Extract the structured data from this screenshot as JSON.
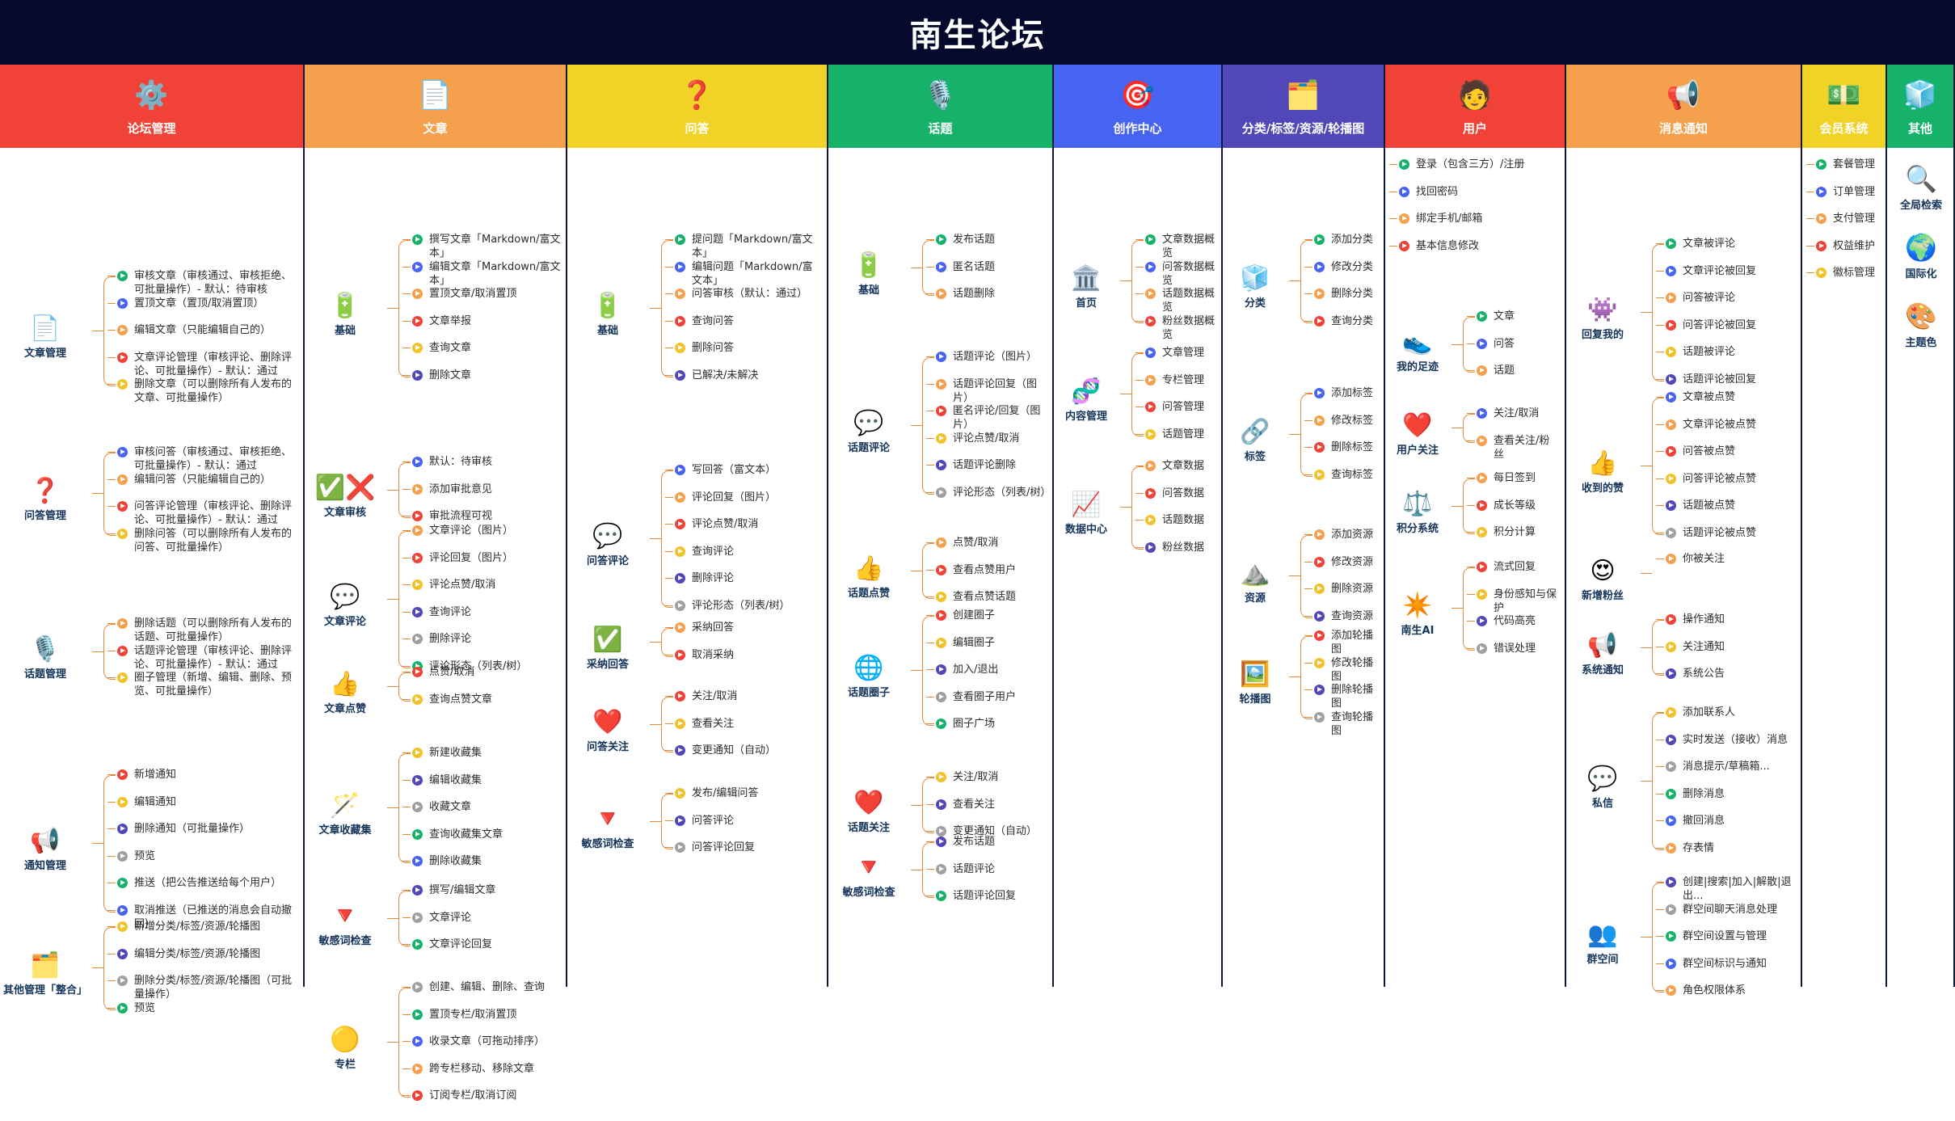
{
  "title": "南生论坛",
  "colors": [
    "#f04236",
    "#f5a04c",
    "#f1d227",
    "#17b26a",
    "#4763f2",
    "#5147b8",
    "#f04236",
    "#f5a04c",
    "#f1d227",
    "#17b26a"
  ],
  "dot_colors": [
    "#17b26a",
    "#4763f2",
    "#f5a04c",
    "#f04236",
    "#f1c229",
    "#5147b8",
    "#a0a0a0"
  ],
  "columns": [
    {
      "name": "论坛管理",
      "icon": "⚙️",
      "groups": [
        {
          "name": "文章管理",
          "icon": "📄",
          "items": [
            "审核文章（审核通过、审核拒绝、可批量操作）- 默认：待审核",
            "置顶文章（置顶/取消置顶）",
            "编辑文章（只能编辑自己的）",
            "文章评论管理（审核评论、删除评论、可批量操作）- 默认：通过",
            "删除文章（可以删除所有人发布的文章、可批量操作）"
          ]
        },
        {
          "name": "问答管理",
          "icon": "❓",
          "items": [
            "审核问答（审核通过、审核拒绝、可批量操作）- 默认：通过",
            "编辑问答（只能编辑自己的）",
            "问答评论管理（审核评论、删除评论、可批量操作）- 默认：通过",
            "删除问答（可以删除所有人发布的问答、可批量操作）"
          ]
        },
        {
          "name": "话题管理",
          "icon": "🎙️",
          "items": [
            "删除话题（可以删除所有人发布的话题、可批量操作）",
            "话题评论管理（审核评论、删除评论、可批量操作）- 默认：通过",
            "圈子管理（新增、编辑、删除、预览、可批量操作）"
          ]
        },
        {
          "name": "通知管理",
          "icon": "📢",
          "items": [
            "新增通知",
            "编辑通知",
            "删除通知（可批量操作）",
            "预览",
            "推送（把公告推送给每个用户）",
            "取消推送（已推送的消息会自动撤回）"
          ]
        },
        {
          "name": "其他管理「整合」",
          "icon": "🗂️",
          "items": [
            "新增分类/标签/资源/轮播图",
            "编辑分类/标签/资源/轮播图",
            "删除分类/标签/资源/轮播图（可批量操作）",
            "预览"
          ]
        }
      ]
    },
    {
      "name": "文章",
      "icon": "📄",
      "groups": [
        {
          "name": "基础",
          "icon": "🔋",
          "items": [
            "撰写文章「Markdown/富文本」",
            "编辑文章「Markdown/富文本」",
            "置顶文章/取消置顶",
            "文章举报",
            "查询文章",
            "删除文章"
          ]
        },
        {
          "name": "文章审核",
          "icon": "✅❌",
          "items": [
            "默认：待审核",
            "添加审批意见",
            "审批流程可视"
          ]
        },
        {
          "name": "文章评论",
          "icon": "💬",
          "items": [
            "文章评论（图片）",
            "评论回复（图片）",
            "评论点赞/取消",
            "查询评论",
            "删除评论",
            "评论形态（列表/树）"
          ]
        },
        {
          "name": "文章点赞",
          "icon": "👍",
          "items": [
            "点赞/取消",
            "查询点赞文章"
          ]
        },
        {
          "name": "文章收藏集",
          "icon": "🪄",
          "items": [
            "新建收藏集",
            "编辑收藏集",
            "收藏文章",
            "查询收藏集文章",
            "删除收藏集"
          ]
        },
        {
          "name": "敏感词检查",
          "icon": "🔻",
          "items": [
            "撰写/编辑文章",
            "文章评论",
            "文章评论回复"
          ]
        },
        {
          "name": "专栏",
          "icon": "🟡",
          "items": [
            "创建、编辑、删除、查询",
            "置顶专栏/取消置顶",
            "收录文章（可拖动排序）",
            "跨专栏移动、移除文章",
            "订阅专栏/取消订阅"
          ]
        }
      ]
    },
    {
      "name": "问答",
      "icon": "❓",
      "groups": [
        {
          "name": "基础",
          "icon": "🔋",
          "items": [
            "提问题「Markdown/富文本」",
            "编辑问题「Markdown/富文本」",
            "问答审核（默认：通过）",
            "查询问答",
            "删除问答",
            "已解决/未解决"
          ]
        },
        {
          "name": "问答评论",
          "icon": "💬",
          "items": [
            "写回答（富文本）",
            "评论回复（图片）",
            "评论点赞/取消",
            "查询评论",
            "删除评论",
            "评论形态（列表/树）"
          ]
        },
        {
          "name": "采纳回答",
          "icon": "✅",
          "items": [
            "采纳回答",
            "取消采纳"
          ]
        },
        {
          "name": "问答关注",
          "icon": "❤️",
          "items": [
            "关注/取消",
            "查看关注",
            "变更通知（自动）"
          ]
        },
        {
          "name": "敏感词检查",
          "icon": "🔻",
          "items": [
            "发布/编辑问答",
            "问答评论",
            "问答评论回复"
          ]
        }
      ]
    },
    {
      "name": "话题",
      "icon": "🎙️",
      "groups": [
        {
          "name": "基础",
          "icon": "🔋",
          "items": [
            "发布话题",
            "匿名话题",
            "话题删除"
          ]
        },
        {
          "name": "话题评论",
          "icon": "💬",
          "items": [
            "话题评论（图片）",
            "话题评论回复（图片）",
            "匿名评论/回复（图片）",
            "评论点赞/取消",
            "话题评论删除",
            "评论形态（列表/树）"
          ]
        },
        {
          "name": "话题点赞",
          "icon": "👍",
          "items": [
            "点赞/取消",
            "查看点赞用户",
            "查看点赞话题"
          ]
        },
        {
          "name": "话题圈子",
          "icon": "🌐",
          "items": [
            "创建圈子",
            "编辑圈子",
            "加入/退出",
            "查看圈子用户",
            "圈子广场"
          ]
        },
        {
          "name": "话题关注",
          "icon": "❤️",
          "items": [
            "关注/取消",
            "查看关注",
            "变更通知（自动）"
          ]
        },
        {
          "name": "敏感词检查",
          "icon": "🔻",
          "items": [
            "发布话题",
            "话题评论",
            "话题评论回复"
          ]
        }
      ]
    },
    {
      "name": "创作中心",
      "icon": "🎯",
      "groups": [
        {
          "name": "首页",
          "icon": "🏛️",
          "items": [
            "文章数据概览",
            "问答数据概览",
            "话题数据概览",
            "粉丝数据概览"
          ]
        },
        {
          "name": "内容管理",
          "icon": "🧬",
          "items": [
            "文章管理",
            "专栏管理",
            "问答管理",
            "话题管理"
          ]
        },
        {
          "name": "数据中心",
          "icon": "📈",
          "items": [
            "文章数据",
            "问答数据",
            "话题数据",
            "粉丝数据"
          ]
        }
      ]
    },
    {
      "name": "分类/标签/资源/轮播图",
      "icon": "🗂️",
      "groups": [
        {
          "name": "分类",
          "icon": "🧊",
          "items": [
            "添加分类",
            "修改分类",
            "删除分类",
            "查询分类"
          ]
        },
        {
          "name": "标签",
          "icon": "🔗",
          "items": [
            "添加标签",
            "修改标签",
            "删除标签",
            "查询标签"
          ]
        },
        {
          "name": "资源",
          "icon": "⛰️",
          "items": [
            "添加资源",
            "修改资源",
            "删除资源",
            "查询资源"
          ]
        },
        {
          "name": "轮播图",
          "icon": "🖼️",
          "items": [
            "添加轮播图",
            "修改轮播图",
            "删除轮播图",
            "查询轮播图"
          ]
        }
      ]
    },
    {
      "name": "用户",
      "icon": "🧑",
      "root_items": [
        "登录（包含三方）/注册",
        "找回密码",
        "绑定手机/邮箱",
        "基本信息修改"
      ],
      "groups": [
        {
          "name": "我的足迹",
          "icon": "👟",
          "items": [
            "文章",
            "问答",
            "话题"
          ]
        },
        {
          "name": "用户关注",
          "icon": "❤️",
          "items": [
            "关注/取消",
            "查看关注/粉丝"
          ]
        },
        {
          "name": "积分系统",
          "icon": "⚖️",
          "items": [
            "每日签到",
            "成长等级",
            "积分计算"
          ]
        },
        {
          "name": "南生AI",
          "icon": "✴️",
          "items": [
            "流式回复",
            "身份感知与保护",
            "代码高亮",
            "错误处理"
          ]
        }
      ]
    },
    {
      "name": "消息通知",
      "icon": "📢",
      "groups": [
        {
          "name": "回复我的",
          "icon": "👾",
          "items": [
            "文章被评论",
            "文章评论被回复",
            "问答被评论",
            "问答评论被回复",
            "话题被评论",
            "话题评论被回复"
          ]
        },
        {
          "name": "收到的赞",
          "icon": "👍",
          "items": [
            "文章被点赞",
            "文章评论被点赞",
            "问答被点赞",
            "问答评论被点赞",
            "话题被点赞",
            "话题评论被点赞"
          ]
        },
        {
          "name": "新增粉丝",
          "icon": "😍",
          "items": [
            "你被关注"
          ]
        },
        {
          "name": "系统通知",
          "icon": "📢",
          "items": [
            "操作通知",
            "关注通知",
            "系统公告"
          ]
        },
        {
          "name": "私信",
          "icon": "💬",
          "items": [
            "添加联系人",
            "实时发送（接收）消息",
            "消息提示/草稿箱...",
            "删除消息",
            "撤回消息",
            "存表情"
          ]
        },
        {
          "name": "群空间",
          "icon": "👥",
          "items": [
            "创建|搜索|加入|解散|退出...",
            "群空间聊天消息处理",
            "群空间设置与管理",
            "群空间标识与通知",
            "角色权限体系"
          ]
        }
      ]
    },
    {
      "name": "会员系统",
      "icon": "💵",
      "root_items": [
        "套餐管理",
        "订单管理",
        "支付管理",
        "权益维护",
        "徽标管理"
      ],
      "groups": []
    },
    {
      "name": "其他",
      "icon": "🧊",
      "simple": [
        {
          "name": "全局检索",
          "icon": "🔍"
        },
        {
          "name": "国际化",
          "icon": "🌍"
        },
        {
          "name": "主题色",
          "icon": "🎨"
        }
      ]
    }
  ]
}
